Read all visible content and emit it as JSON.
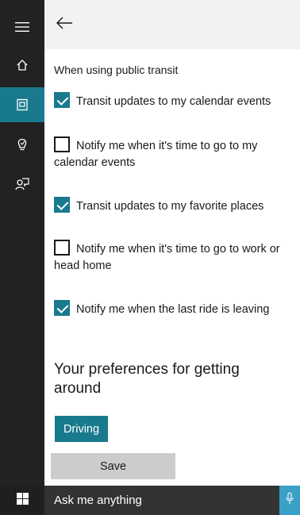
{
  "sidebar": {
    "items": [
      {
        "icon": "hamburger-menu-icon",
        "active": false
      },
      {
        "icon": "home-icon",
        "active": false
      },
      {
        "icon": "notebook-icon",
        "active": true
      },
      {
        "icon": "lightbulb-icon",
        "active": false
      },
      {
        "icon": "feedback-icon",
        "active": false
      }
    ]
  },
  "header": {
    "back_icon": "back-arrow-icon"
  },
  "section": {
    "label": "When using public transit"
  },
  "options": [
    {
      "label": "Transit updates to my calendar events",
      "checked": true
    },
    {
      "label": "Notify me when it's time to go to my calendar events",
      "checked": false
    },
    {
      "label": "Transit updates to my favorite places",
      "checked": true
    },
    {
      "label": "Notify me when it's time to go to work or head home",
      "checked": false
    },
    {
      "label": "Notify me when the last ride is leaving",
      "checked": true
    }
  ],
  "preferences": {
    "heading": "Your preferences for getting around",
    "mode_button": "Driving",
    "save_button": "Save"
  },
  "taskbar": {
    "search_text": "Ask me anything",
    "start_icon": "windows-logo-icon",
    "mic_icon": "microphone-icon"
  },
  "colors": {
    "accent": "#1a7a8d",
    "sidebar": "#222222",
    "taskbar": "#333333",
    "mic": "#3aa0c8"
  }
}
